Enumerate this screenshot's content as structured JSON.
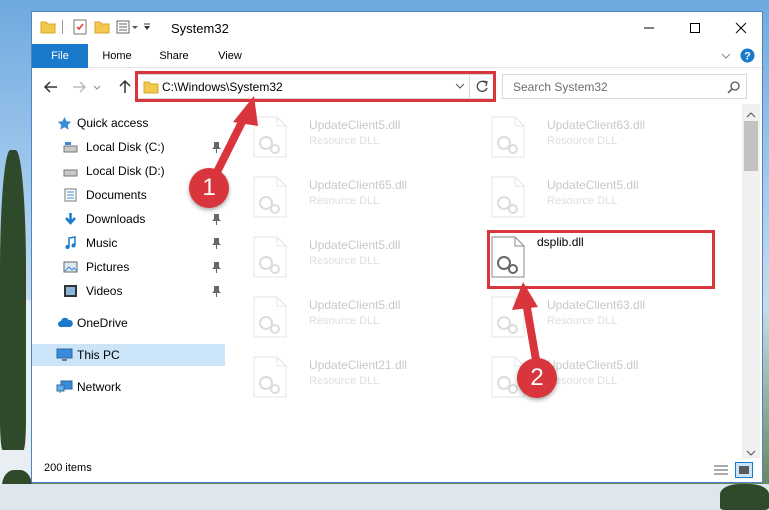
{
  "window": {
    "title": "System32"
  },
  "ribbon": {
    "tabs": [
      "File",
      "Home",
      "Share",
      "View"
    ]
  },
  "navigation": {
    "address": "C:\\Windows\\System32",
    "search_placeholder": "Search System32"
  },
  "sidebar": {
    "items": [
      {
        "label": "Quick access",
        "icon": "star-icon",
        "pinned": false
      },
      {
        "label": "Local Disk (C:)",
        "icon": "drive-icon",
        "pinned": true
      },
      {
        "label": "Local Disk (D:)",
        "icon": "drive-icon",
        "pinned": false
      },
      {
        "label": "Documents",
        "icon": "document-folder-icon",
        "pinned": false
      },
      {
        "label": "Downloads",
        "icon": "download-icon",
        "pinned": true
      },
      {
        "label": "Music",
        "icon": "music-icon",
        "pinned": true
      },
      {
        "label": "Pictures",
        "icon": "pictures-icon",
        "pinned": true
      },
      {
        "label": "Videos",
        "icon": "videos-icon",
        "pinned": true
      },
      {
        "label": "OneDrive",
        "icon": "cloud-icon",
        "pinned": false
      },
      {
        "label": "This PC",
        "icon": "computer-icon",
        "pinned": false,
        "selected": true
      },
      {
        "label": "Network",
        "icon": "network-icon",
        "pinned": false
      }
    ]
  },
  "files": {
    "left_column": [
      {
        "name": "UpdateClient5.dll",
        "type": "Resource DLL"
      },
      {
        "name": "UpdateClient65.dll",
        "type": "Resource DLL"
      },
      {
        "name": "UpdateClient5.dll",
        "type": "Resource DLL"
      },
      {
        "name": "UpdateClient5.dll",
        "type": "Resource DLL"
      },
      {
        "name": "UpdateClient21.dll",
        "type": "Resource DLL"
      }
    ],
    "right_column": [
      {
        "name": "UpdateClient63.dll",
        "type": "Resource DLL"
      },
      {
        "name": "UpdateClient5.dll",
        "type": "Resource DLL"
      },
      {
        "name": "dsplib.dll",
        "type": ""
      },
      {
        "name": "UpdateClient63.dll",
        "type": "Resource DLL"
      },
      {
        "name": "UpdateClient5.dll",
        "type": "Resource DLL"
      }
    ]
  },
  "status": {
    "item_count": "200 items"
  },
  "annotations": {
    "step1": "1",
    "step2": "2",
    "color": "#d9353c"
  },
  "colors": {
    "accent": "#1979ca",
    "selection": "#cce4f7"
  }
}
